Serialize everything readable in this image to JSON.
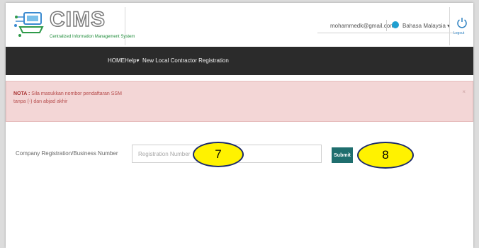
{
  "app": {
    "logo_text": "CIMS",
    "logo_tagline": "Centralized Information Management System"
  },
  "header": {
    "user_email": "mohammedk@gmail.com ▾",
    "language": "Bahasa Malaysia ▾",
    "logout_label": "Logout",
    "icons": [
      "cims-logo-icon",
      "globe-icon",
      "power-icon"
    ]
  },
  "nav": {
    "items": [
      "HOME",
      "Help▾",
      "New Local Contractor Registration"
    ]
  },
  "alert": {
    "label": "NOTA :",
    "line1": "Sila masukkan nombor pendaftaran SSM",
    "line2": "tanpa (-) dan abjad akhir",
    "close": "×"
  },
  "form": {
    "label": "Company Registration/Business Number",
    "input_placeholder": "Registration Number",
    "input_value": "",
    "submit_label": "Submit"
  },
  "callouts": {
    "step_input": "7",
    "step_submit": "8"
  },
  "colors": {
    "navbar": "#2b2b2b",
    "alert_bg": "#f3d6d6",
    "submit": "#1f6e6e",
    "callout_fill": "#fff200",
    "callout_border": "#1b2a6b"
  }
}
